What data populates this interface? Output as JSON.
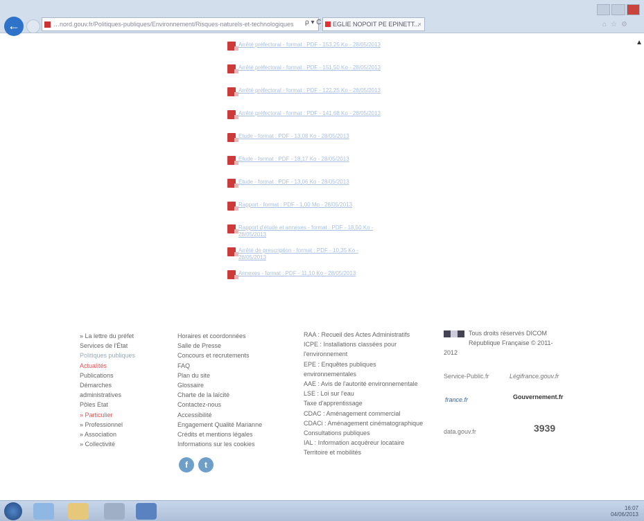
{
  "browser": {
    "address_url": "…nord.gouv.fr/Politiques-publiques/Environnement/Risques-naturels-et-technologiques",
    "address_tools": "ρ ▾ C",
    "tab_title": "EGLIE NOPOIT PE EPINETT...",
    "tab_close": "×",
    "back_glyph": "←"
  },
  "scroll_up_glyph": "▲",
  "documents": [
    {
      "label": "Arrêté préfectoral - format : PDF - 153,25 Ko - 28/05/2013"
    },
    {
      "label": "Arrêté préfectoral - format : PDF - 151,50 Ko - 28/05/2013"
    },
    {
      "label": "Arrêté préfectoral - format : PDF - 122,25 Ko - 28/05/2013"
    },
    {
      "label": "Arrêté préfectoral - format : PDF - 141,68 Ko - 28/05/2013"
    },
    {
      "label": "Etude - format : PDF - 13,08 Ko - 28/05/2013"
    },
    {
      "label": "Etude - format : PDF - 18,17 Ko - 28/05/2013"
    },
    {
      "label": "Etude - format : PDF - 13,06 Ko - 28/05/2013"
    },
    {
      "label": "Rapport - format : PDF - 1,00 Mo - 28/05/2013"
    },
    {
      "label": "Rapport d'étude et annexes - format : PDF - 18,50 Ko - 28/05/2013"
    },
    {
      "label": "Arrêté de prescription - format : PDF - 10,35 Ko - 28/05/2013"
    },
    {
      "label": "Annexes - format : PDF - 11,10 Ko - 28/05/2013"
    }
  ],
  "footer": {
    "col1": [
      {
        "text": "» La lettre du préfet",
        "cls": ""
      },
      {
        "text": "Services de l'État",
        "cls": ""
      },
      {
        "text": "Politiques publiques",
        "cls": "muted"
      },
      {
        "text": "Actualités",
        "cls": "red"
      },
      {
        "text": "Publications",
        "cls": ""
      },
      {
        "text": "Démarches",
        "cls": ""
      },
      {
        "text": "administratives",
        "cls": ""
      },
      {
        "text": "Pôles Etat",
        "cls": ""
      },
      {
        "text": "» Particulier",
        "cls": "red"
      },
      {
        "text": "» Professionnel",
        "cls": ""
      },
      {
        "text": "» Association",
        "cls": ""
      },
      {
        "text": "» Collectivité",
        "cls": ""
      }
    ],
    "col2": [
      {
        "text": "Horaires et coordonnées",
        "cls": ""
      },
      {
        "text": "Salle de Presse",
        "cls": ""
      },
      {
        "text": "Concours et recrutements",
        "cls": ""
      },
      {
        "text": "FAQ",
        "cls": ""
      },
      {
        "text": "Plan du site",
        "cls": ""
      },
      {
        "text": "Glossaire",
        "cls": ""
      },
      {
        "text": "Charte de la laïcité",
        "cls": ""
      },
      {
        "text": "Contactez-nous",
        "cls": ""
      },
      {
        "text": "Accessibilité",
        "cls": ""
      },
      {
        "text": "Engagement Qualité Marianne",
        "cls": ""
      },
      {
        "text": "Crédits et mentions légales",
        "cls": ""
      },
      {
        "text": "Informations sur les cookies",
        "cls": ""
      }
    ],
    "col3": [
      {
        "text": "RAA : Recueil des Actes Administratifs",
        "cls": ""
      },
      {
        "text": "ICPE : Installations classées pour",
        "cls": ""
      },
      {
        "text": "l'environnement",
        "cls": ""
      },
      {
        "text": "EPE : Enquêtes publiques",
        "cls": ""
      },
      {
        "text": "environnementales",
        "cls": ""
      },
      {
        "text": "AAE : Avis de l'autorité environnementale",
        "cls": ""
      },
      {
        "text": "LSE : Loi sur l'eau",
        "cls": ""
      },
      {
        "text": "Taxe d'apprentissage",
        "cls": ""
      },
      {
        "text": "CDAC : Aménagement commercial",
        "cls": ""
      },
      {
        "text": "CDACi : Aménagement cinématographique",
        "cls": ""
      },
      {
        "text": "Consultations publiques",
        "cls": ""
      },
      {
        "text": "IAL : Information acquéreur locataire",
        "cls": ""
      },
      {
        "text": "Territoire et mobilités",
        "cls": ""
      }
    ],
    "rights_line1": "Tous droits réservés DICOM",
    "rights_line2": "République Française © 2011-",
    "rights_line3": "2012",
    "logo_service_public": "Service-Public.fr",
    "logo_legifrance": "Légifrance.gouv.fr",
    "logo_france": "france.fr",
    "logo_gouvernement": "Gouvernement.fr",
    "logo_data": "data.gouv.fr",
    "logo_3939": "3939",
    "social_facebook": "f",
    "social_twitter": "t"
  },
  "taskbar": {
    "time": "16:07",
    "date": "04/06/2013"
  }
}
